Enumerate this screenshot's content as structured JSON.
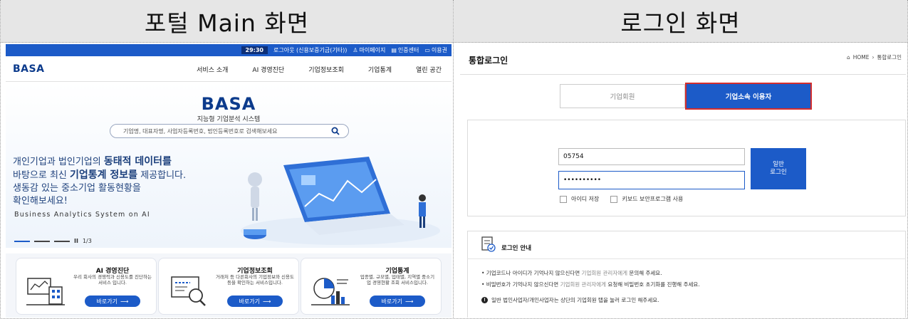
{
  "headers": {
    "left": "포털 Main 화면",
    "right": "로그인 화면"
  },
  "portal": {
    "utilbar": {
      "timer": "29:30",
      "logout": "로그아웃 (신용보증기금(기타))",
      "mypage": "마이페이지",
      "cert": "인증센터",
      "guide": "이용권"
    },
    "logo": "BASA",
    "menu": [
      "서비스 소개",
      "AI 경영진단",
      "기업정보조회",
      "기업통계",
      "열린 공간"
    ],
    "hero": {
      "logo": "BASA",
      "subtitle": "지능형 기업분석 시스템",
      "search_placeholder": "기업명, 대표자명, 사업자등록번호, 법인등록번호로 검색해보세요",
      "line1_a": "개인기업과 법인기업의 ",
      "line1_b": "동태적 데이터를",
      "line2_a": "바탕으로 최신 ",
      "line2_b": "기업통계 정보를",
      "line2_c": " 제공합니다.",
      "line3": "생동감 있는 중소기업 활동현황을",
      "line4": "확인해보세요!",
      "english": "Business Analytics System on AI",
      "slide_counter": "1/3",
      "pause": "II"
    },
    "cards": [
      {
        "title": "AI 경영진단",
        "desc": "우리 회사의 경쟁력과 신용도를 진단하는 서비스 입니다.",
        "button": "바로가기"
      },
      {
        "title": "기업정보조회",
        "desc": "거래처 등 다른회사의 기업정보와 신용도 등을 확인하는 서비스입니다.",
        "button": "바로가기"
      },
      {
        "title": "기업통계",
        "desc": "업종별, 규모별, 업태별, 지역별 중소기업 경영현황 조회 서비스입니다.",
        "button": "바로가기"
      }
    ]
  },
  "login": {
    "title": "통합로그인",
    "breadcrumb": {
      "home": "HOME",
      "current": "통합로그인"
    },
    "tabs": {
      "member": "기업회원",
      "affiliate": "기업소속 이용자"
    },
    "id_value": "05754",
    "pw_value": "••••••••••",
    "login_button_line1": "일반",
    "login_button_line2": "로그인",
    "save_id": "아이디 저장",
    "keyboard_security": "키보드 보안프로그램 사용",
    "guide": {
      "title": "로그인 안내",
      "item1_a": "• 기업코드나 아이디가 기억나지 않으신다면 ",
      "item1_b": "기업회원 관리자에게",
      "item1_c": " 문의해 주세요.",
      "item2_a": "• 비밀번호가 기억나지 않으신다면 ",
      "item2_b": "기업회원 관리자에게",
      "item2_c": " 요청해 비밀번호 초기화를 진행해 주세요.",
      "note": "일반 법인사업자/개인사업자는 상단의 기업회원 탭을 눌러 로그인 해주세요.",
      "note_mark": "!"
    }
  },
  "colors": {
    "brand": "#1c5bc8",
    "logo": "#0c3b8c",
    "highlight": "#d32d2d"
  }
}
